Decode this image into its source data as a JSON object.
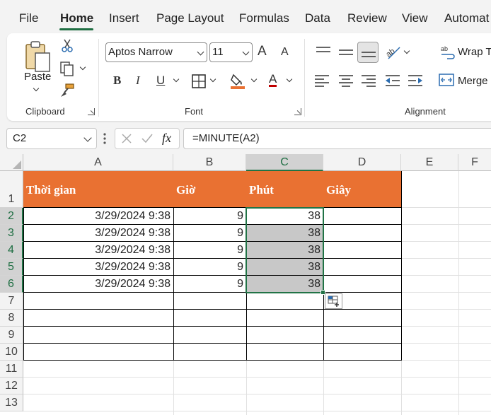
{
  "menu": {
    "tabs": [
      "File",
      "Home",
      "Insert",
      "Page Layout",
      "Formulas",
      "Data",
      "Review",
      "View",
      "Automat"
    ],
    "active": "Home"
  },
  "ribbon": {
    "clipboard": {
      "paste_label": "Paste",
      "group_label": "Clipboard"
    },
    "font": {
      "font_name": "Aptos Narrow",
      "font_size": "11",
      "bold": "B",
      "italic": "I",
      "underline": "U",
      "grow": "A",
      "shrink": "A",
      "font_color_letter": "A",
      "group_label": "Font",
      "fill_color": "#e97132",
      "font_color": "#c00000"
    },
    "alignment": {
      "wrap_text": "Wrap T",
      "merge": "Merge",
      "group_label": "Alignment"
    }
  },
  "formula_bar": {
    "name_box": "C2",
    "fx": "fx",
    "formula": "=MINUTE(A2)"
  },
  "columns": [
    "A",
    "B",
    "C",
    "D",
    "E",
    "F"
  ],
  "selected_column": "C",
  "rows": [
    "1",
    "2",
    "3",
    "4",
    "5",
    "6",
    "7",
    "8",
    "9",
    "10",
    "11",
    "12",
    "13"
  ],
  "selected_rows": [
    "2",
    "3",
    "4",
    "5",
    "6"
  ],
  "table": {
    "headers": [
      "Thời gian",
      "Giờ",
      "Phút",
      "Giây"
    ],
    "rows": [
      [
        "3/29/2024 9:38",
        "9",
        "38",
        ""
      ],
      [
        "3/29/2024 9:38",
        "9",
        "38",
        ""
      ],
      [
        "3/29/2024 9:38",
        "9",
        "38",
        ""
      ],
      [
        "3/29/2024 9:38",
        "9",
        "38",
        ""
      ],
      [
        "3/29/2024 9:38",
        "9",
        "38",
        ""
      ]
    ],
    "header_color": "#e97132"
  }
}
